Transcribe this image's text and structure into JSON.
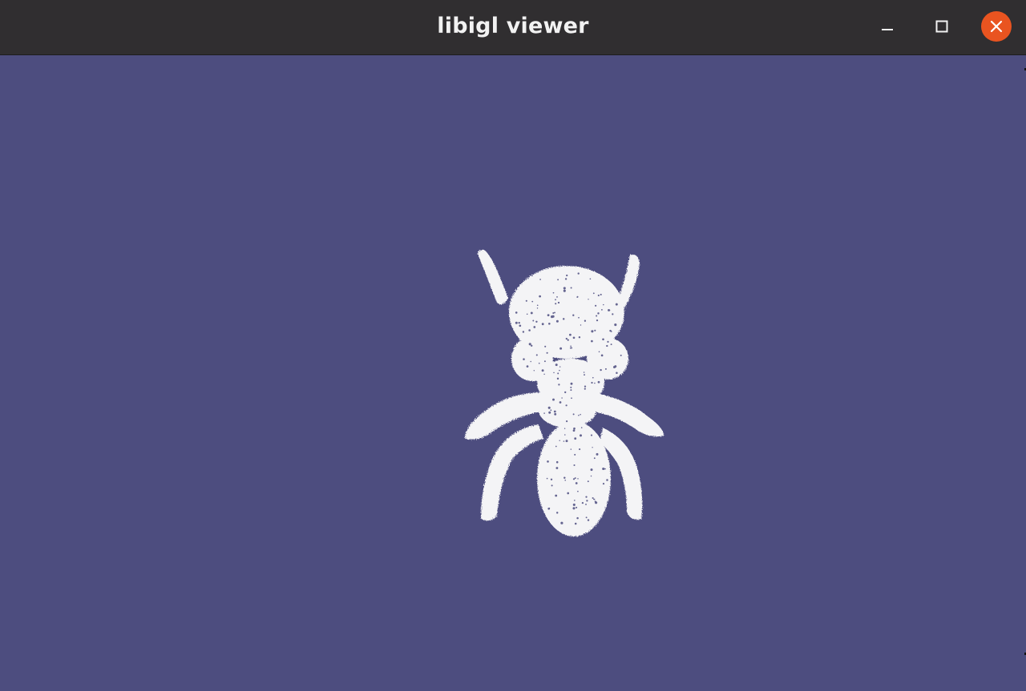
{
  "window": {
    "title": "libigl viewer"
  },
  "controls": {
    "minimize": "minimize-icon",
    "maximize": "maximize-icon",
    "close": "close-icon"
  },
  "colors": {
    "titlebar": "#302e30",
    "title_text": "#f2f2f2",
    "viewport_background": "#4d4d7f",
    "close_button": "#e95420",
    "mesh": "#f5f5f5"
  },
  "scene": {
    "model": "ant-mesh",
    "render_mode": "point-cloud"
  }
}
